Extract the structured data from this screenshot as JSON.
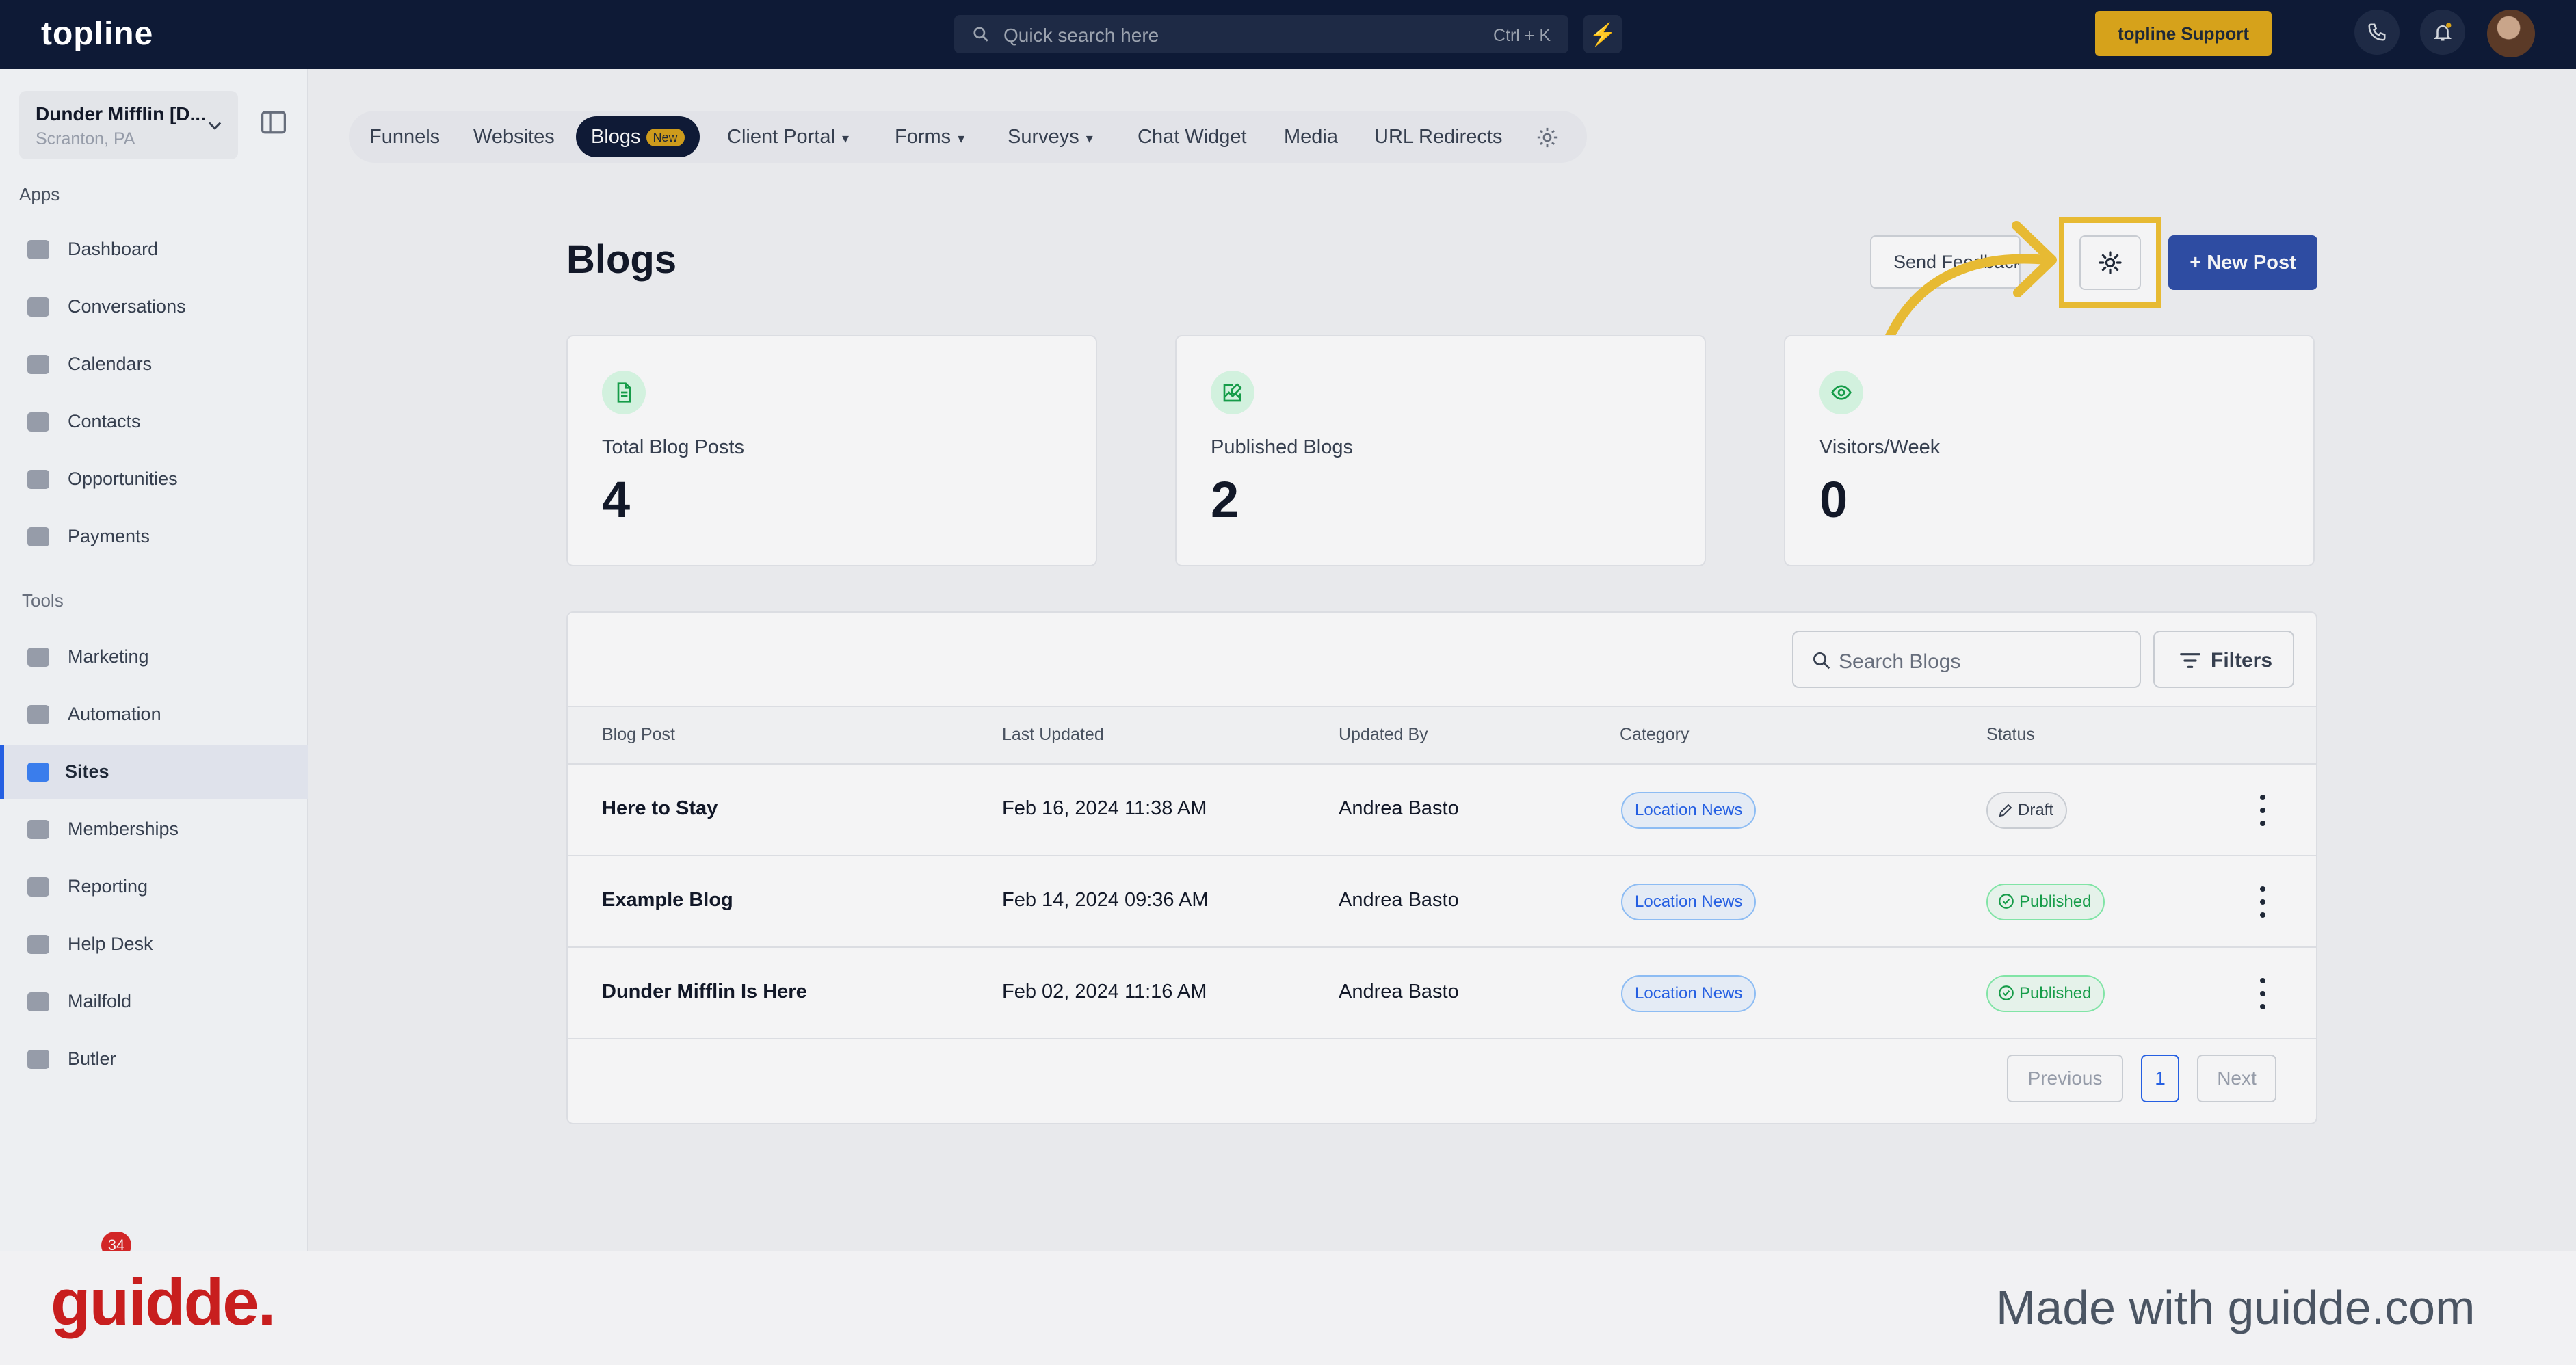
{
  "topbar": {
    "logo": "topline",
    "search_placeholder": "Quick search here",
    "search_shortcut": "Ctrl + K",
    "bolt_icon": "lightning-icon",
    "support_label": "topline Support"
  },
  "sidebar": {
    "account_name": "Dunder Mifflin [D...",
    "account_location": "Scranton, PA",
    "apps_title": "Apps",
    "apps": [
      {
        "label": "Dashboard",
        "icon": "dashboard-icon"
      },
      {
        "label": "Conversations",
        "icon": "chat-icon"
      },
      {
        "label": "Calendars",
        "icon": "calendar-icon"
      },
      {
        "label": "Contacts",
        "icon": "person-icon"
      },
      {
        "label": "Opportunities",
        "icon": "target-icon"
      },
      {
        "label": "Payments",
        "icon": "card-icon"
      }
    ],
    "tools_title": "Tools",
    "tools": [
      {
        "label": "Marketing",
        "icon": "megaphone-icon"
      },
      {
        "label": "Automation",
        "icon": "gears-icon"
      },
      {
        "label": "Sites",
        "icon": "globe-icon",
        "active": true
      },
      {
        "label": "Memberships",
        "icon": "users-icon"
      },
      {
        "label": "Reporting",
        "icon": "pie-chart-icon"
      },
      {
        "label": "Help Desk",
        "icon": "help-icon"
      },
      {
        "label": "Mailfold",
        "icon": "mail-icon"
      },
      {
        "label": "Butler",
        "icon": "butler-icon"
      }
    ],
    "notification_count": "34"
  },
  "subnav": {
    "tabs": [
      {
        "label": "Funnels"
      },
      {
        "label": "Websites"
      },
      {
        "label": "Blogs",
        "badge": "New",
        "active": true
      },
      {
        "label": "Client Portal",
        "dropdown": true
      },
      {
        "label": "Forms",
        "dropdown": true
      },
      {
        "label": "Surveys",
        "dropdown": true
      },
      {
        "label": "Chat Widget"
      },
      {
        "label": "Media"
      },
      {
        "label": "URL Redirects"
      }
    ],
    "settings_icon": "gear-icon"
  },
  "main": {
    "title": "Blogs",
    "send_feedback_label": "Send Feedback",
    "new_post_label": "+ New Post",
    "stats": [
      {
        "label": "Total Blog Posts",
        "value": "4",
        "icon": "document-icon"
      },
      {
        "label": "Published Blogs",
        "value": "2",
        "icon": "image-edit-icon"
      },
      {
        "label": "Visitors/Week",
        "value": "0",
        "icon": "eye-icon"
      }
    ],
    "table": {
      "search_placeholder": "Search Blogs",
      "filters_label": "Filters",
      "columns": [
        "Blog Post",
        "Last Updated",
        "Updated By",
        "Category",
        "Status"
      ],
      "rows": [
        {
          "post": "Here to Stay",
          "updated": "Feb 16, 2024 11:38 AM",
          "by": "Andrea Basto",
          "category": "Location News",
          "status": "Draft"
        },
        {
          "post": "Example Blog",
          "updated": "Feb 14, 2024 09:36 AM",
          "by": "Andrea Basto",
          "category": "Location News",
          "status": "Published"
        },
        {
          "post": "Dunder Mifflin Is Here",
          "updated": "Feb 02, 2024 11:16 AM",
          "by": "Andrea Basto",
          "category": "Location News",
          "status": "Published"
        }
      ],
      "pagination": {
        "previous": "Previous",
        "page": "1",
        "next": "Next"
      }
    }
  },
  "footer": {
    "logo": "guidde.",
    "made_with": "Made with guidde.com"
  },
  "colors": {
    "topbar": "#0e1a36",
    "accent": "#2f4ea8",
    "support": "#d6a21b",
    "highlight": "#f2c233",
    "published": "#16a34a",
    "brand_red": "#c81e1e"
  }
}
